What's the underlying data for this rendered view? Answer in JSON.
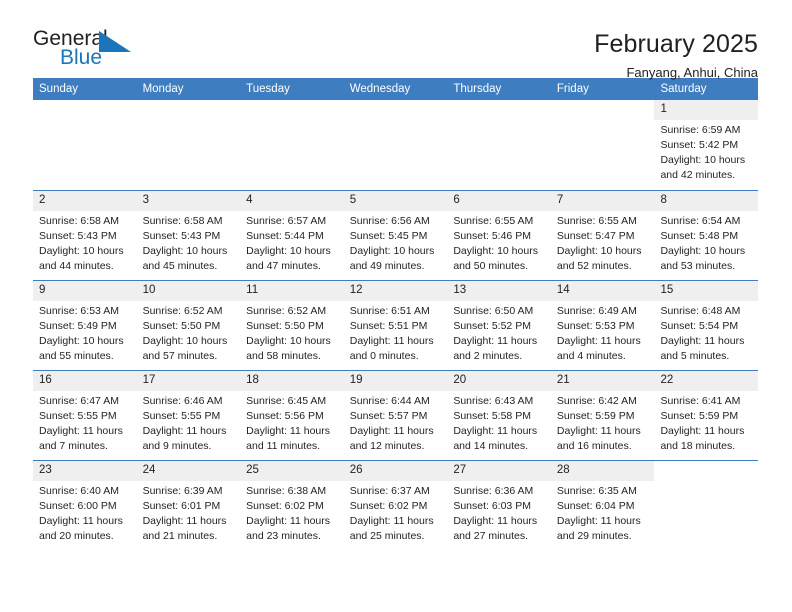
{
  "brand": {
    "name_part1": "General",
    "name_part2": "Blue",
    "flag_icon": "triangle-flag-icon",
    "accent_color": "#1b75bb"
  },
  "header": {
    "title": "February 2025",
    "subtitle": "Fanyang, Anhui, China"
  },
  "calendar": {
    "header_color": "#3d7dc0",
    "daynum_background": "#efefef",
    "weekdays": [
      "Sunday",
      "Monday",
      "Tuesday",
      "Wednesday",
      "Thursday",
      "Friday",
      "Saturday"
    ],
    "weeks": [
      [
        {
          "day": "",
          "empty": true,
          "sunrise": "",
          "sunset": "",
          "daylight_line1": "",
          "daylight_line2": ""
        },
        {
          "day": "",
          "empty": true,
          "sunrise": "",
          "sunset": "",
          "daylight_line1": "",
          "daylight_line2": ""
        },
        {
          "day": "",
          "empty": true,
          "sunrise": "",
          "sunset": "",
          "daylight_line1": "",
          "daylight_line2": ""
        },
        {
          "day": "",
          "empty": true,
          "sunrise": "",
          "sunset": "",
          "daylight_line1": "",
          "daylight_line2": ""
        },
        {
          "day": "",
          "empty": true,
          "sunrise": "",
          "sunset": "",
          "daylight_line1": "",
          "daylight_line2": ""
        },
        {
          "day": "",
          "empty": true,
          "sunrise": "",
          "sunset": "",
          "daylight_line1": "",
          "daylight_line2": ""
        },
        {
          "day": "1",
          "empty": false,
          "sunrise": "Sunrise: 6:59 AM",
          "sunset": "Sunset: 5:42 PM",
          "daylight_line1": "Daylight: 10 hours",
          "daylight_line2": "and 42 minutes."
        }
      ],
      [
        {
          "day": "2",
          "empty": false,
          "sunrise": "Sunrise: 6:58 AM",
          "sunset": "Sunset: 5:43 PM",
          "daylight_line1": "Daylight: 10 hours",
          "daylight_line2": "and 44 minutes."
        },
        {
          "day": "3",
          "empty": false,
          "sunrise": "Sunrise: 6:58 AM",
          "sunset": "Sunset: 5:43 PM",
          "daylight_line1": "Daylight: 10 hours",
          "daylight_line2": "and 45 minutes."
        },
        {
          "day": "4",
          "empty": false,
          "sunrise": "Sunrise: 6:57 AM",
          "sunset": "Sunset: 5:44 PM",
          "daylight_line1": "Daylight: 10 hours",
          "daylight_line2": "and 47 minutes."
        },
        {
          "day": "5",
          "empty": false,
          "sunrise": "Sunrise: 6:56 AM",
          "sunset": "Sunset: 5:45 PM",
          "daylight_line1": "Daylight: 10 hours",
          "daylight_line2": "and 49 minutes."
        },
        {
          "day": "6",
          "empty": false,
          "sunrise": "Sunrise: 6:55 AM",
          "sunset": "Sunset: 5:46 PM",
          "daylight_line1": "Daylight: 10 hours",
          "daylight_line2": "and 50 minutes."
        },
        {
          "day": "7",
          "empty": false,
          "sunrise": "Sunrise: 6:55 AM",
          "sunset": "Sunset: 5:47 PM",
          "daylight_line1": "Daylight: 10 hours",
          "daylight_line2": "and 52 minutes."
        },
        {
          "day": "8",
          "empty": false,
          "sunrise": "Sunrise: 6:54 AM",
          "sunset": "Sunset: 5:48 PM",
          "daylight_line1": "Daylight: 10 hours",
          "daylight_line2": "and 53 minutes."
        }
      ],
      [
        {
          "day": "9",
          "empty": false,
          "sunrise": "Sunrise: 6:53 AM",
          "sunset": "Sunset: 5:49 PM",
          "daylight_line1": "Daylight: 10 hours",
          "daylight_line2": "and 55 minutes."
        },
        {
          "day": "10",
          "empty": false,
          "sunrise": "Sunrise: 6:52 AM",
          "sunset": "Sunset: 5:50 PM",
          "daylight_line1": "Daylight: 10 hours",
          "daylight_line2": "and 57 minutes."
        },
        {
          "day": "11",
          "empty": false,
          "sunrise": "Sunrise: 6:52 AM",
          "sunset": "Sunset: 5:50 PM",
          "daylight_line1": "Daylight: 10 hours",
          "daylight_line2": "and 58 minutes."
        },
        {
          "day": "12",
          "empty": false,
          "sunrise": "Sunrise: 6:51 AM",
          "sunset": "Sunset: 5:51 PM",
          "daylight_line1": "Daylight: 11 hours",
          "daylight_line2": "and 0 minutes."
        },
        {
          "day": "13",
          "empty": false,
          "sunrise": "Sunrise: 6:50 AM",
          "sunset": "Sunset: 5:52 PM",
          "daylight_line1": "Daylight: 11 hours",
          "daylight_line2": "and 2 minutes."
        },
        {
          "day": "14",
          "empty": false,
          "sunrise": "Sunrise: 6:49 AM",
          "sunset": "Sunset: 5:53 PM",
          "daylight_line1": "Daylight: 11 hours",
          "daylight_line2": "and 4 minutes."
        },
        {
          "day": "15",
          "empty": false,
          "sunrise": "Sunrise: 6:48 AM",
          "sunset": "Sunset: 5:54 PM",
          "daylight_line1": "Daylight: 11 hours",
          "daylight_line2": "and 5 minutes."
        }
      ],
      [
        {
          "day": "16",
          "empty": false,
          "sunrise": "Sunrise: 6:47 AM",
          "sunset": "Sunset: 5:55 PM",
          "daylight_line1": "Daylight: 11 hours",
          "daylight_line2": "and 7 minutes."
        },
        {
          "day": "17",
          "empty": false,
          "sunrise": "Sunrise: 6:46 AM",
          "sunset": "Sunset: 5:55 PM",
          "daylight_line1": "Daylight: 11 hours",
          "daylight_line2": "and 9 minutes."
        },
        {
          "day": "18",
          "empty": false,
          "sunrise": "Sunrise: 6:45 AM",
          "sunset": "Sunset: 5:56 PM",
          "daylight_line1": "Daylight: 11 hours",
          "daylight_line2": "and 11 minutes."
        },
        {
          "day": "19",
          "empty": false,
          "sunrise": "Sunrise: 6:44 AM",
          "sunset": "Sunset: 5:57 PM",
          "daylight_line1": "Daylight: 11 hours",
          "daylight_line2": "and 12 minutes."
        },
        {
          "day": "20",
          "empty": false,
          "sunrise": "Sunrise: 6:43 AM",
          "sunset": "Sunset: 5:58 PM",
          "daylight_line1": "Daylight: 11 hours",
          "daylight_line2": "and 14 minutes."
        },
        {
          "day": "21",
          "empty": false,
          "sunrise": "Sunrise: 6:42 AM",
          "sunset": "Sunset: 5:59 PM",
          "daylight_line1": "Daylight: 11 hours",
          "daylight_line2": "and 16 minutes."
        },
        {
          "day": "22",
          "empty": false,
          "sunrise": "Sunrise: 6:41 AM",
          "sunset": "Sunset: 5:59 PM",
          "daylight_line1": "Daylight: 11 hours",
          "daylight_line2": "and 18 minutes."
        }
      ],
      [
        {
          "day": "23",
          "empty": false,
          "sunrise": "Sunrise: 6:40 AM",
          "sunset": "Sunset: 6:00 PM",
          "daylight_line1": "Daylight: 11 hours",
          "daylight_line2": "and 20 minutes."
        },
        {
          "day": "24",
          "empty": false,
          "sunrise": "Sunrise: 6:39 AM",
          "sunset": "Sunset: 6:01 PM",
          "daylight_line1": "Daylight: 11 hours",
          "daylight_line2": "and 21 minutes."
        },
        {
          "day": "25",
          "empty": false,
          "sunrise": "Sunrise: 6:38 AM",
          "sunset": "Sunset: 6:02 PM",
          "daylight_line1": "Daylight: 11 hours",
          "daylight_line2": "and 23 minutes."
        },
        {
          "day": "26",
          "empty": false,
          "sunrise": "Sunrise: 6:37 AM",
          "sunset": "Sunset: 6:02 PM",
          "daylight_line1": "Daylight: 11 hours",
          "daylight_line2": "and 25 minutes."
        },
        {
          "day": "27",
          "empty": false,
          "sunrise": "Sunrise: 6:36 AM",
          "sunset": "Sunset: 6:03 PM",
          "daylight_line1": "Daylight: 11 hours",
          "daylight_line2": "and 27 minutes."
        },
        {
          "day": "28",
          "empty": false,
          "sunrise": "Sunrise: 6:35 AM",
          "sunset": "Sunset: 6:04 PM",
          "daylight_line1": "Daylight: 11 hours",
          "daylight_line2": "and 29 minutes."
        },
        {
          "day": "",
          "empty": true,
          "sunrise": "",
          "sunset": "",
          "daylight_line1": "",
          "daylight_line2": ""
        }
      ]
    ]
  }
}
